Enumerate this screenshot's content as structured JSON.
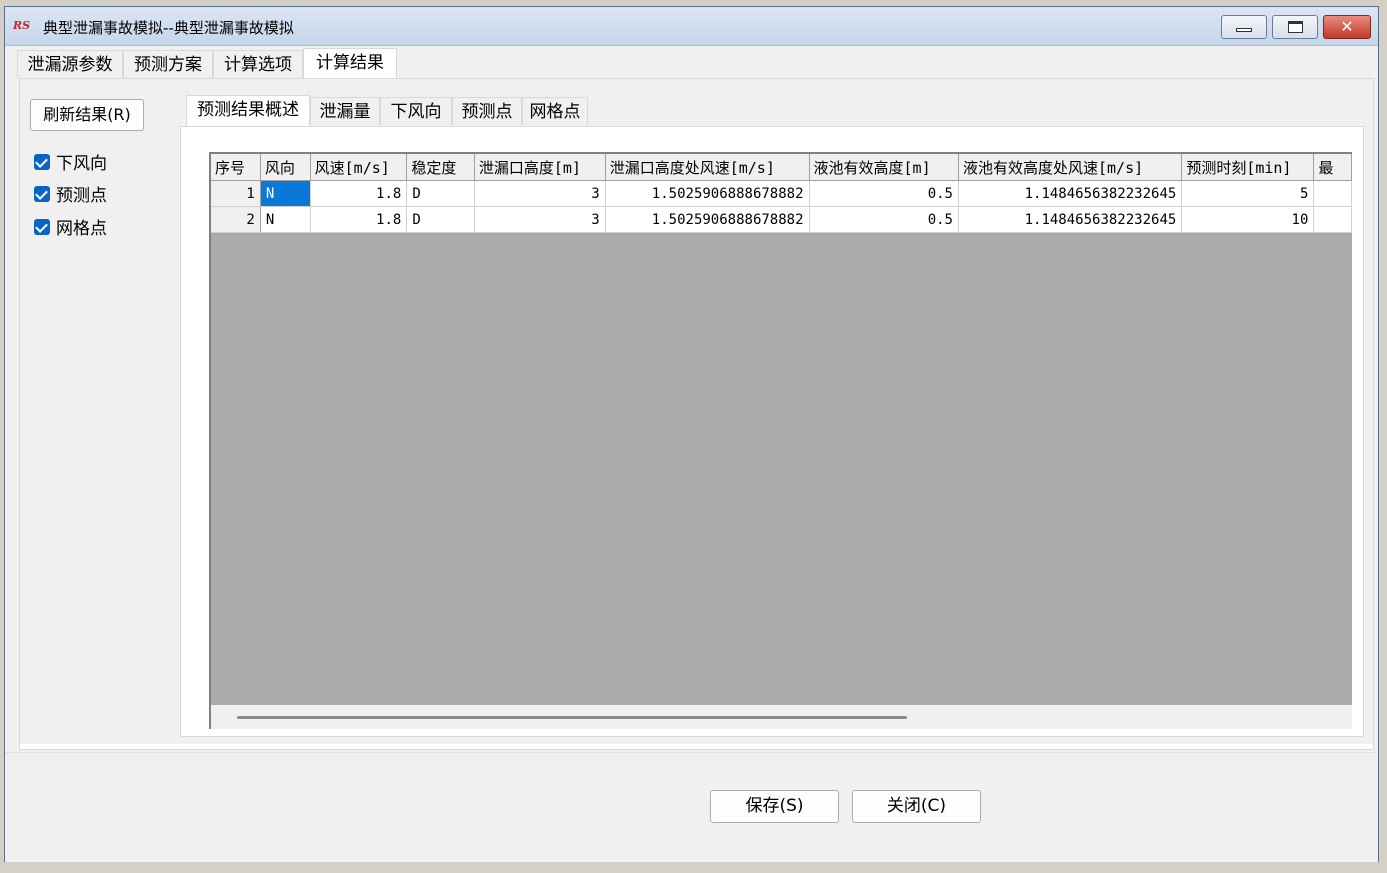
{
  "window": {
    "logo_text": "RS",
    "title": "典型泄漏事故模拟--典型泄漏事故模拟",
    "close_glyph": "✕"
  },
  "tabs": [
    "泄漏源参数",
    "预测方案",
    "计算选项",
    "计算结果"
  ],
  "active_tab": "计算结果",
  "left_panel": {
    "refresh_label": "刷新结果(R)",
    "checkboxes": [
      {
        "label": "下风向",
        "checked": true
      },
      {
        "label": "预测点",
        "checked": true
      },
      {
        "label": "网格点",
        "checked": true
      }
    ]
  },
  "subtabs": [
    "预测结果概述",
    "泄漏量",
    "下风向",
    "预测点",
    "网格点"
  ],
  "active_subtab": "预测结果概述",
  "table": {
    "headers": [
      "序号",
      "风向",
      "风速[m/s]",
      "稳定度",
      "泄漏口高度[m]",
      "泄漏口高度处风速[m/s]",
      "液池有效高度[m]",
      "液池有效高度处风速[m/s]",
      "预测时刻[min]",
      "最"
    ],
    "rows": [
      [
        "1",
        "N",
        "1.8",
        "D",
        "3",
        "1.5025906888678882",
        "0.5",
        "1.1484656382232645",
        "5",
        ""
      ],
      [
        "2",
        "N",
        "1.8",
        "D",
        "3",
        "1.5025906888678882",
        "0.5",
        "1.1484656382232645",
        "10",
        ""
      ]
    ]
  },
  "footer": {
    "save_label": "保存(S)",
    "close_label": "关闭(C)"
  }
}
